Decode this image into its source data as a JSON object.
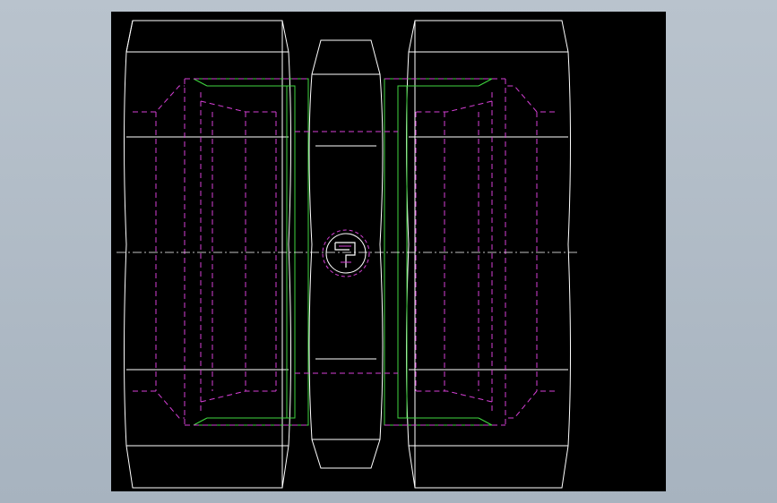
{
  "drawing": {
    "background": "#000000",
    "window_background": "#b0bbc6",
    "colors": {
      "outline": "#ffffff",
      "hidden_lines": "#d63fd6",
      "green_lines": "#3fd63f",
      "centerline": "#ffffff"
    },
    "views": [
      "left-hex-nut",
      "center-hex-body",
      "right-hex-nut"
    ],
    "icons": [
      "origin-symbol-icon"
    ]
  }
}
